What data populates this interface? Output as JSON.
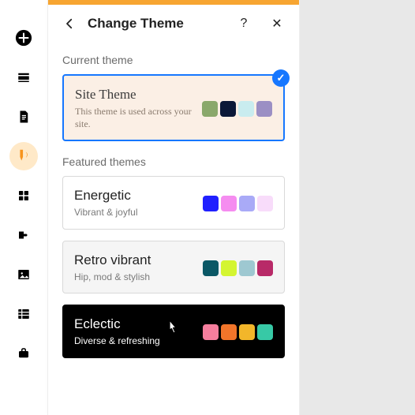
{
  "panel": {
    "title": "Change Theme",
    "help": "?",
    "close": "✕"
  },
  "sections": {
    "current_label": "Current theme",
    "featured_label": "Featured themes"
  },
  "current_theme": {
    "name": "Site Theme",
    "desc": "This theme is used across your site.",
    "swatches": [
      "#8aa86b",
      "#0b1838",
      "#c9ecef",
      "#9b8fc4"
    ]
  },
  "featured": [
    {
      "name": "Energetic",
      "desc": "Vibrant & joyful",
      "swatches": [
        "#2020ff",
        "#f58cf0",
        "#a9aaf7",
        "#f8dcfa"
      ],
      "variant": "light"
    },
    {
      "name": "Retro vibrant",
      "desc": "Hip, mod & stylish",
      "swatches": [
        "#0b5866",
        "#d4f531",
        "#9ec8d1",
        "#b82a68"
      ],
      "variant": "hover"
    },
    {
      "name": "Eclectic",
      "desc": "Diverse & refreshing",
      "swatches": [
        "#f57e9e",
        "#f2752a",
        "#f2b62a",
        "#37c9a6"
      ],
      "variant": "dark"
    }
  ],
  "check_mark": "✓"
}
